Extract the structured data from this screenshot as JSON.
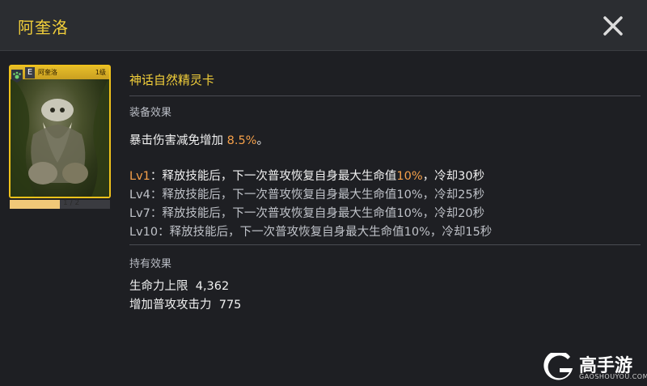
{
  "header": {
    "title": "阿奎洛"
  },
  "card": {
    "grade": "E",
    "name": "阿奎洛",
    "level": "1级",
    "progress_text": "1 / 2",
    "progress_fraction": 0.5,
    "badge_icon": "paw-icon"
  },
  "details": {
    "card_type": "神话自然精灵卡",
    "equip_label": "装备效果",
    "equip_prefix": "暴击伤害减免增加 ",
    "equip_value": "8.5%",
    "equip_suffix": "。",
    "levels": [
      {
        "lv": "Lv1",
        "text_a": "：释放技能后，下一次普攻恢复自身最大生命值",
        "pct": "10%",
        "text_b": "，冷却30秒"
      },
      {
        "lv": "Lv4",
        "text_a": "：释放技能后，下一次普攻恢复自身最大生命值",
        "pct": "10%",
        "text_b": "，冷却25秒"
      },
      {
        "lv": "Lv7",
        "text_a": "：释放技能后，下一次普攻恢复自身最大生命值",
        "pct": "10%",
        "text_b": "，冷却20秒"
      },
      {
        "lv": "Lv10",
        "text_a": "：释放技能后，下一次普攻恢复自身最大生命值",
        "pct": "10%",
        "text_b": "，冷却15秒"
      }
    ],
    "hold_label": "持有效果",
    "hold_stats": [
      {
        "name": "生命力上限",
        "value": "4,362"
      },
      {
        "name": "增加普攻攻击力",
        "value": "775"
      }
    ]
  },
  "watermark": {
    "brand": "高手游",
    "domain": "GAOSHOUYOU.COM"
  },
  "colors": {
    "accent": "#f2cf3a",
    "highlight": "#f5a04a",
    "background": "#1e1f23"
  }
}
